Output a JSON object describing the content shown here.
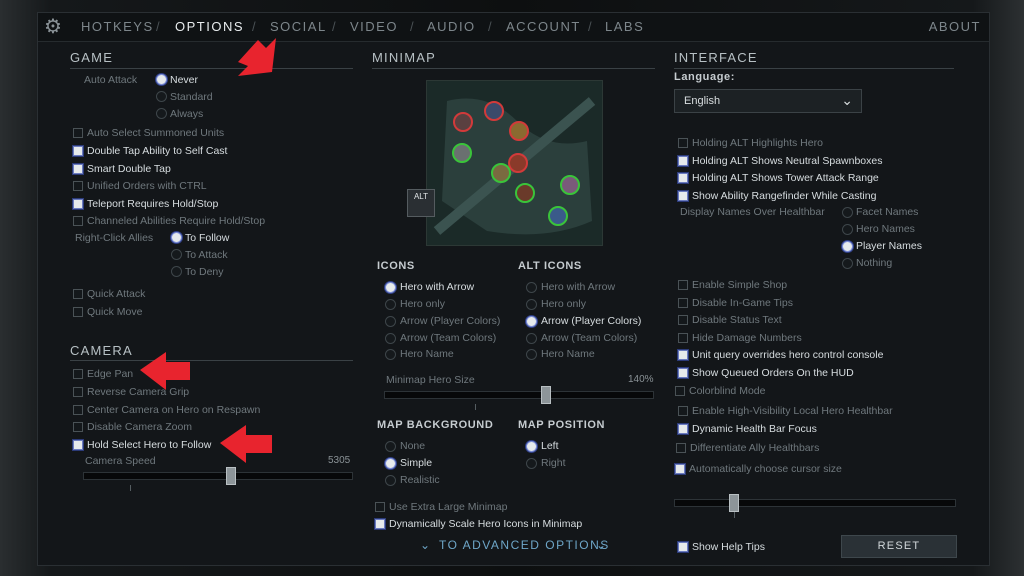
{
  "nav": {
    "tabs": [
      "HOTKEYS",
      "OPTIONS",
      "SOCIAL",
      "VIDEO",
      "AUDIO",
      "ACCOUNT",
      "LABS"
    ],
    "active": "OPTIONS",
    "about": "ABOUT"
  },
  "game": {
    "title": "GAME",
    "auto_attack_label": "Auto Attack",
    "auto_attack_options": [
      "Never",
      "Standard",
      "Always"
    ],
    "auto_select_summoned": "Auto Select Summoned Units",
    "double_tap_self_cast": "Double Tap Ability to Self Cast",
    "smart_double_tap": "Smart Double Tap",
    "unified_orders": "Unified Orders with CTRL",
    "teleport_hold_stop": "Teleport Requires Hold/Stop",
    "channeled_hold_stop": "Channeled Abilities Require Hold/Stop",
    "right_click_allies_label": "Right-Click Allies",
    "right_click_options": [
      "To Follow",
      "To Attack",
      "To Deny"
    ],
    "quick_attack": "Quick Attack",
    "quick_move": "Quick Move"
  },
  "camera": {
    "title": "CAMERA",
    "edge_pan": "Edge Pan",
    "reverse_grip": "Reverse Camera Grip",
    "center_respawn": "Center Camera on Hero on Respawn",
    "disable_zoom": "Disable Camera Zoom",
    "hold_select_follow": "Hold Select Hero to Follow",
    "speed_label": "Camera Speed",
    "speed_value": "5305"
  },
  "minimap": {
    "title": "MINIMAP",
    "alt_key": "ALT",
    "icons_title": "ICONS",
    "alt_icons_title": "ALT ICONS",
    "icon_options": [
      "Hero with Arrow",
      "Hero only",
      "Arrow (Player Colors)",
      "Arrow (Team Colors)",
      "Hero Name"
    ],
    "hero_size_label": "Minimap Hero Size",
    "hero_size_value": "140%",
    "bg_title": "MAP BACKGROUND",
    "bg_options": [
      "None",
      "Simple",
      "Realistic"
    ],
    "pos_title": "MAP POSITION",
    "pos_options": [
      "Left",
      "Right"
    ],
    "extra_large": "Use Extra Large Minimap",
    "dynamic_scale": "Dynamically Scale Hero Icons in Minimap",
    "advanced": "TO ADVANCED OPTIONS"
  },
  "interface": {
    "title": "INTERFACE",
    "language_label": "Language:",
    "language_value": "English",
    "alt_highlights": "Holding ALT Highlights Hero",
    "alt_spawnboxes": "Holding ALT Shows Neutral Spawnboxes",
    "alt_tower_range": "Holding ALT Shows Tower Attack Range",
    "rangefinder": "Show Ability Rangefinder While Casting",
    "display_names_label": "Display Names Over Healthbar",
    "display_names_options": [
      "Facet Names",
      "Hero Names",
      "Player Names",
      "Nothing"
    ],
    "simple_shop": "Enable Simple Shop",
    "disable_tips": "Disable In-Game Tips",
    "disable_status": "Disable Status Text",
    "hide_damage": "Hide Damage Numbers",
    "unit_query": "Unit query overrides hero control console",
    "queued_orders": "Show Queued Orders On the HUD",
    "colorblind": "Colorblind Mode",
    "high_vis": "Enable High-Visibility Local Hero Healthbar",
    "dynamic_health": "Dynamic Health Bar Focus",
    "diff_ally": "Differentiate Ally Healthbars",
    "auto_cursor": "Automatically choose cursor size",
    "show_help": "Show Help Tips",
    "reset": "RESET"
  },
  "colors": {
    "accent": "#6ea6c8",
    "annotation_arrow": "#e8242e"
  }
}
